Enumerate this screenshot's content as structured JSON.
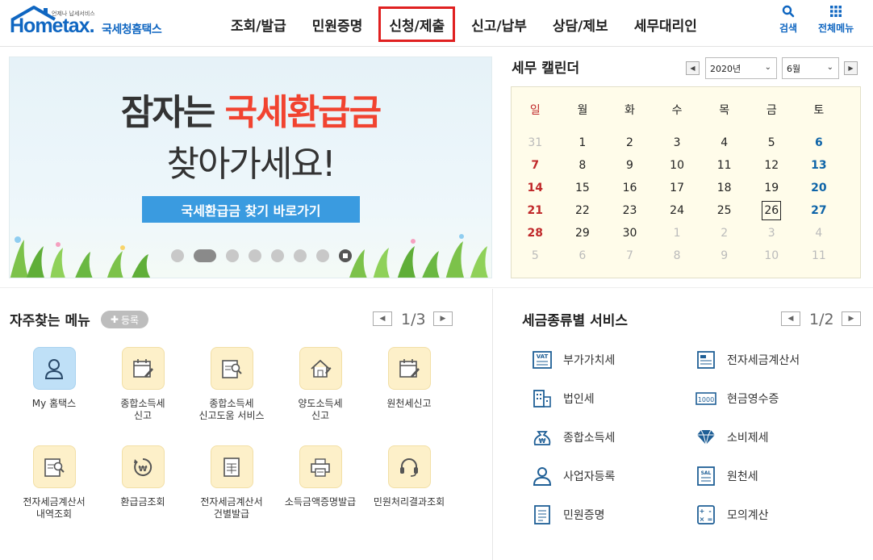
{
  "header": {
    "logo_sub": "언제나 납세서비스",
    "logo_word": "Hometax.",
    "logo_kr": "국세청홈택스",
    "nav": [
      "조회/발급",
      "민원증명",
      "신청/제출",
      "신고/납부",
      "상담/제보",
      "세무대리인"
    ],
    "active_nav_index": 2,
    "search_label": "검색",
    "allmenu_label": "전체메뉴",
    "accent": "#0f66c1",
    "highlight": "#e02020"
  },
  "banner": {
    "line1_a": "잠자는 ",
    "line1_b": "국세환급금",
    "line2": "찾아가세요!",
    "button": "국세환급금 찾기 바로가기",
    "slide_count": 7,
    "active_slide": 1
  },
  "calendar": {
    "title": "세무 캘린더",
    "year": "2020년",
    "month": "6월",
    "weekdays": [
      "일",
      "월",
      "화",
      "수",
      "목",
      "금",
      "토"
    ],
    "weeks": [
      [
        "31",
        "1",
        "2",
        "3",
        "4",
        "5",
        "6"
      ],
      [
        "7",
        "8",
        "9",
        "10",
        "11",
        "12",
        "13"
      ],
      [
        "14",
        "15",
        "16",
        "17",
        "18",
        "19",
        "20"
      ],
      [
        "21",
        "22",
        "23",
        "24",
        "25",
        "26",
        "27"
      ],
      [
        "28",
        "29",
        "30",
        "1",
        "2",
        "3",
        "4"
      ],
      [
        "5",
        "6",
        "7",
        "8",
        "9",
        "10",
        "11"
      ]
    ],
    "today": "26"
  },
  "favorites": {
    "title": "자주찾는 메뉴",
    "register": "등록",
    "page": "1/3",
    "items": [
      {
        "label": "My 홈택스",
        "icon": "user-icon"
      },
      {
        "label": "종합소득세\n신고",
        "icon": "calendar-pen-icon"
      },
      {
        "label": "종합소득세\n신고도움 서비스",
        "icon": "document-search-icon"
      },
      {
        "label": "양도소득세\n신고",
        "icon": "house-pen-icon"
      },
      {
        "label": "원천세신고",
        "icon": "calendar-pen-icon"
      },
      {
        "label": "전자세금계산서\n내역조회",
        "icon": "document-search-icon"
      },
      {
        "label": "환급금조회",
        "icon": "refund-icon"
      },
      {
        "label": "전자세금계산서\n건별발급",
        "icon": "invoice-icon"
      },
      {
        "label": "소득금액증명발급",
        "icon": "printer-icon"
      },
      {
        "label": "민원처리결과조회",
        "icon": "headset-icon"
      }
    ]
  },
  "tax_services": {
    "title": "세금종류별 서비스",
    "page": "1/2",
    "items": [
      {
        "label": "부가가치세",
        "icon": "vat-icon"
      },
      {
        "label": "전자세금계산서",
        "icon": "e-invoice-icon"
      },
      {
        "label": "법인세",
        "icon": "building-icon"
      },
      {
        "label": "현금영수증",
        "icon": "receipt-icon"
      },
      {
        "label": "종합소득세",
        "icon": "money-bag-icon"
      },
      {
        "label": "소비제세",
        "icon": "diamond-icon"
      },
      {
        "label": "사업자등록",
        "icon": "person-icon"
      },
      {
        "label": "원천세",
        "icon": "salary-icon"
      },
      {
        "label": "민원증명",
        "icon": "document-icon"
      },
      {
        "label": "모의계산",
        "icon": "calculator-icon"
      }
    ]
  }
}
